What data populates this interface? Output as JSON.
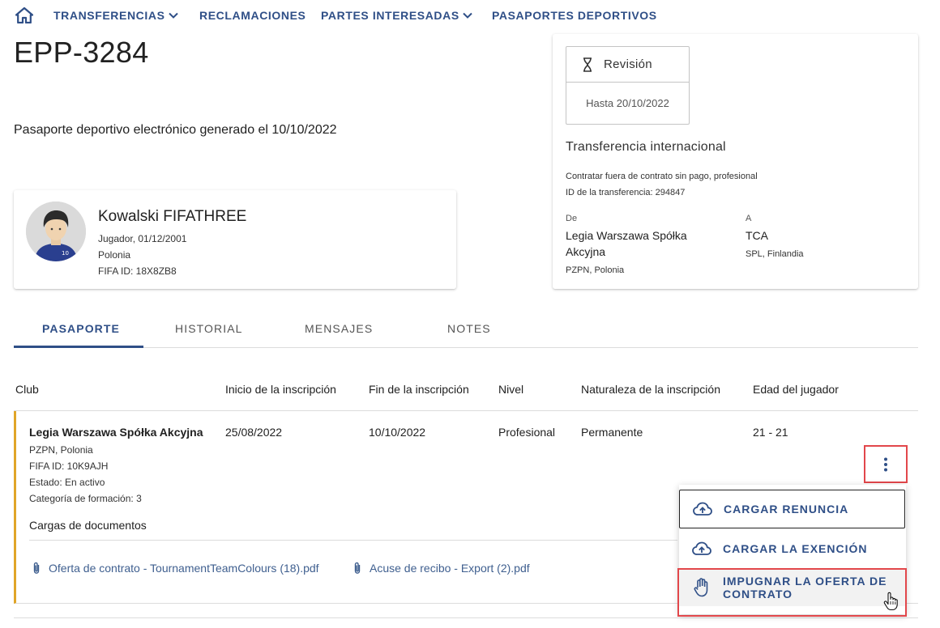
{
  "nav": {
    "items": [
      {
        "label": "TRANSFERENCIAS",
        "dropdown": true
      },
      {
        "label": "RECLAMACIONES",
        "dropdown": false
      },
      {
        "label": "PARTES INTERESADAS",
        "dropdown": true
      },
      {
        "label": "PASAPORTES DEPORTIVOS",
        "dropdown": false
      }
    ]
  },
  "page": {
    "title": "EPP-3284",
    "subtitle": "Pasaporte deportivo electrónico generado el 10/10/2022"
  },
  "player": {
    "name": "Kowalski FIFATHREE",
    "role_dob": "Jugador, 01/12/2001",
    "country": "Polonia",
    "fifa_id": "FIFA ID: 18X8ZB8",
    "shirt_number": "10"
  },
  "transfer": {
    "status_label": "Revisión",
    "status_until": "Hasta 20/10/2022",
    "heading": "Transferencia internacional",
    "description": "Contratar fuera de contrato sin pago, profesional",
    "transfer_id": "ID de la transferencia: 294847",
    "from_label": "De",
    "from_name": "Legia Warszawa Spółka Akcyjna",
    "from_sub": "PZPN, Polonia",
    "to_label": "A",
    "to_name": "TCA",
    "to_sub": "SPL, Finlandia"
  },
  "tabs": [
    {
      "label": "PASAPORTE",
      "active": true
    },
    {
      "label": "HISTORIAL",
      "active": false
    },
    {
      "label": "MENSAJES",
      "active": false
    },
    {
      "label": "NOTES",
      "active": false
    }
  ],
  "table": {
    "headers": [
      "Club",
      "Inicio de la inscripción",
      "Fin de la inscripción",
      "Nivel",
      "Naturaleza de la inscripción",
      "Edad del jugador"
    ],
    "row": {
      "club": "Legia Warszawa Spółka Akcyjna",
      "federation": "PZPN, Polonia",
      "fifa_id": "FIFA ID: 10K9AJH",
      "status": "Estado: En activo",
      "category": "Categoría de formación: 3",
      "start": "25/08/2022",
      "end": "10/10/2022",
      "level": "Profesional",
      "nature": "Permanente",
      "age": "21 - 21",
      "docs_title": "Cargas de documentos",
      "documents": [
        "Oferta de contrato - TournamentTeamColours (18).pdf",
        "Acuse de recibo - Export (2).pdf"
      ]
    }
  },
  "menu": {
    "items": [
      {
        "label": "CARGAR RENUNCIA",
        "icon": "cloud-upload-icon"
      },
      {
        "label": "CARGAR LA EXENCIÓN",
        "icon": "cloud-upload-icon"
      },
      {
        "label": "IMPUGNAR LA OFERTA DE CONTRATO",
        "icon": "hand-icon"
      }
    ]
  },
  "colors": {
    "primary": "#2f4f87",
    "row_accent": "#e0a528",
    "highlight": "#e2474b"
  }
}
